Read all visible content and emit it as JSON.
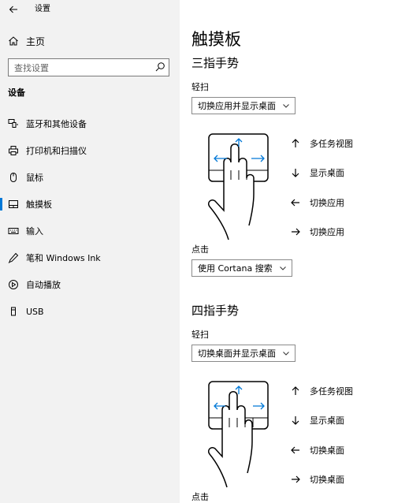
{
  "window": {
    "title": "设置"
  },
  "sidebar": {
    "home_label": "主页",
    "search_placeholder": "查找设置",
    "section_title": "设备",
    "items": [
      {
        "label": "蓝牙和其他设备",
        "icon": "bluetooth-icon"
      },
      {
        "label": "打印机和扫描仪",
        "icon": "printer-icon"
      },
      {
        "label": "鼠标",
        "icon": "mouse-icon"
      },
      {
        "label": "触摸板",
        "icon": "touchpad-icon",
        "active": true
      },
      {
        "label": "输入",
        "icon": "keyboard-icon"
      },
      {
        "label": "笔和 Windows Ink",
        "icon": "pen-icon"
      },
      {
        "label": "自动播放",
        "icon": "autoplay-icon"
      },
      {
        "label": "USB",
        "icon": "usb-icon"
      }
    ]
  },
  "main": {
    "title": "触摸板",
    "three_finger": {
      "heading": "三指手势",
      "swipe_label": "轻扫",
      "swipe_value": "切换应用并显示桌面",
      "gestures": [
        "多任务视图",
        "显示桌面",
        "切换应用",
        "切换应用"
      ],
      "tap_label": "点击",
      "tap_value": "使用 Cortana 搜索"
    },
    "four_finger": {
      "heading": "四指手势",
      "swipe_label": "轻扫",
      "swipe_value": "切换桌面并显示桌面",
      "gestures": [
        "多任务视图",
        "显示桌面",
        "切换桌面",
        "切换桌面"
      ],
      "tap_label": "点击"
    }
  },
  "colors": {
    "accent": "#0078d7",
    "sidebar_bg": "#f2f2f2"
  }
}
